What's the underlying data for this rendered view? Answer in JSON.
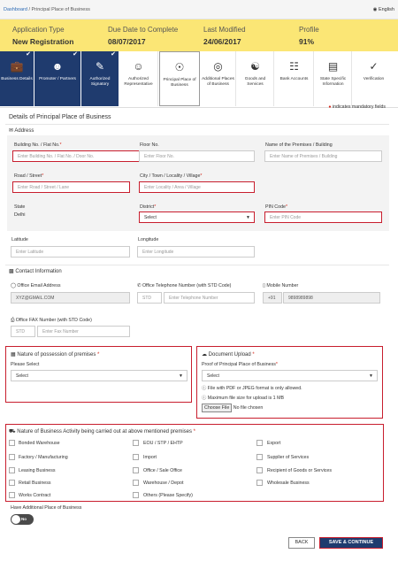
{
  "breadcrumb": {
    "home": "Dashboard",
    "sep": "/",
    "current": "Principal Place of Business"
  },
  "language": "English",
  "info": {
    "app_type_label": "Application Type",
    "app_type_value": "New Registration",
    "due_label": "Due Date to Complete",
    "due_value": "08/07/2017",
    "modified_label": "Last Modified",
    "modified_value": "24/06/2017",
    "profile_label": "Profile",
    "profile_value": "91%"
  },
  "steps": [
    {
      "label": "Business Details",
      "icon": "briefcase-icon",
      "done": true
    },
    {
      "label": "Promoter / Partners",
      "icon": "user-group-icon",
      "done": true
    },
    {
      "label": "Authorized Signatory",
      "icon": "signatory-icon",
      "done": true
    },
    {
      "label": "Authorized Representative",
      "icon": "representative-icon",
      "done": false
    },
    {
      "label": "Principal Place of Business",
      "icon": "location-pin-icon",
      "done": false,
      "active": true
    },
    {
      "label": "Additional Places of Business",
      "icon": "map-pin-plus-icon",
      "done": false
    },
    {
      "label": "Goods and Services",
      "icon": "goods-icon",
      "done": false
    },
    {
      "label": "Bank Accounts",
      "icon": "bank-icon",
      "done": false
    },
    {
      "label": "State Specific Information",
      "icon": "document-icon",
      "done": false
    },
    {
      "label": "Verification",
      "icon": "check-circle-icon",
      "done": false
    }
  ],
  "mandatory_note": "indicates mandatory fields",
  "page_title": "Details of Principal Place of Business",
  "address": {
    "title": "Address",
    "building_label": "Building No. / Flat No.",
    "building_ph": "Enter Building No. / Flat No. / Door No.",
    "floor_label": "Floor No.",
    "floor_ph": "Enter Floor No.",
    "premises_label": "Name of the Premises / Building",
    "premises_ph": "Enter Name of Premises / Building",
    "road_label": "Road / Street",
    "road_ph": "Enter Road / Street / Lane",
    "city_label": "City / Town / Locality / Village",
    "city_ph": "Enter Locality / Area / Village",
    "state_label": "State",
    "state_value": "Delhi",
    "district_label": "District",
    "district_value": "Select",
    "pin_label": "PIN Code",
    "pin_ph": "Enter PIN Code",
    "lat_label": "Latitude",
    "lat_ph": "Enter Latitude",
    "long_label": "Longitude",
    "long_ph": "Enter Longitude"
  },
  "contact": {
    "title": "Contact Information",
    "email_label": "Office Email Address",
    "email_value": "XYZ@GMAIL.COM",
    "phone_label": "Office Telephone Number (with STD Code)",
    "phone_std_ph": "STD",
    "phone_ph": "Enter Telephone Number",
    "mobile_label": "Mobile Number",
    "mobile_code": "+91",
    "mobile_value": "9898989898",
    "fax_label": "Office FAX Number (with STD Code)",
    "fax_std_ph": "STD",
    "fax_ph": "Enter Fax Number"
  },
  "possession": {
    "title": "Nature of possession of premises",
    "select_label": "Please Select",
    "select_value": "Select"
  },
  "upload": {
    "title": "Document Upload",
    "proof_label": "Proof of Principal Place of Business",
    "proof_value": "Select",
    "info1": "File with PDF or JPEG format is only allowed.",
    "info2": "Maximum file size for upload is 1 MB",
    "choose": "Choose File",
    "no_file": "No file chosen"
  },
  "activity": {
    "title": "Nature of Business Activity being carried out at above mentioned premises",
    "col1": [
      "Bonded Warehouse",
      "Factory / Manufacturing",
      "Leasing Business",
      "Retail Business",
      "Works Contract"
    ],
    "col2": [
      "EOU / STP / EHTP",
      "Import",
      "Office / Sale Office",
      "Warehouse / Depot",
      "Others (Please Specify)"
    ],
    "col3": [
      "Export",
      "Supplier of Services",
      "Recipient of Goods or Services",
      "Wholesale Business"
    ]
  },
  "additional": {
    "label": "Have Additional Place of Business",
    "toggle": "No"
  },
  "buttons": {
    "back": "BACK",
    "save": "SAVE & CONTINUE"
  },
  "colors": {
    "navy": "#1f3b6e",
    "yellow": "#fbe675",
    "error_red": "#c81e2e"
  }
}
